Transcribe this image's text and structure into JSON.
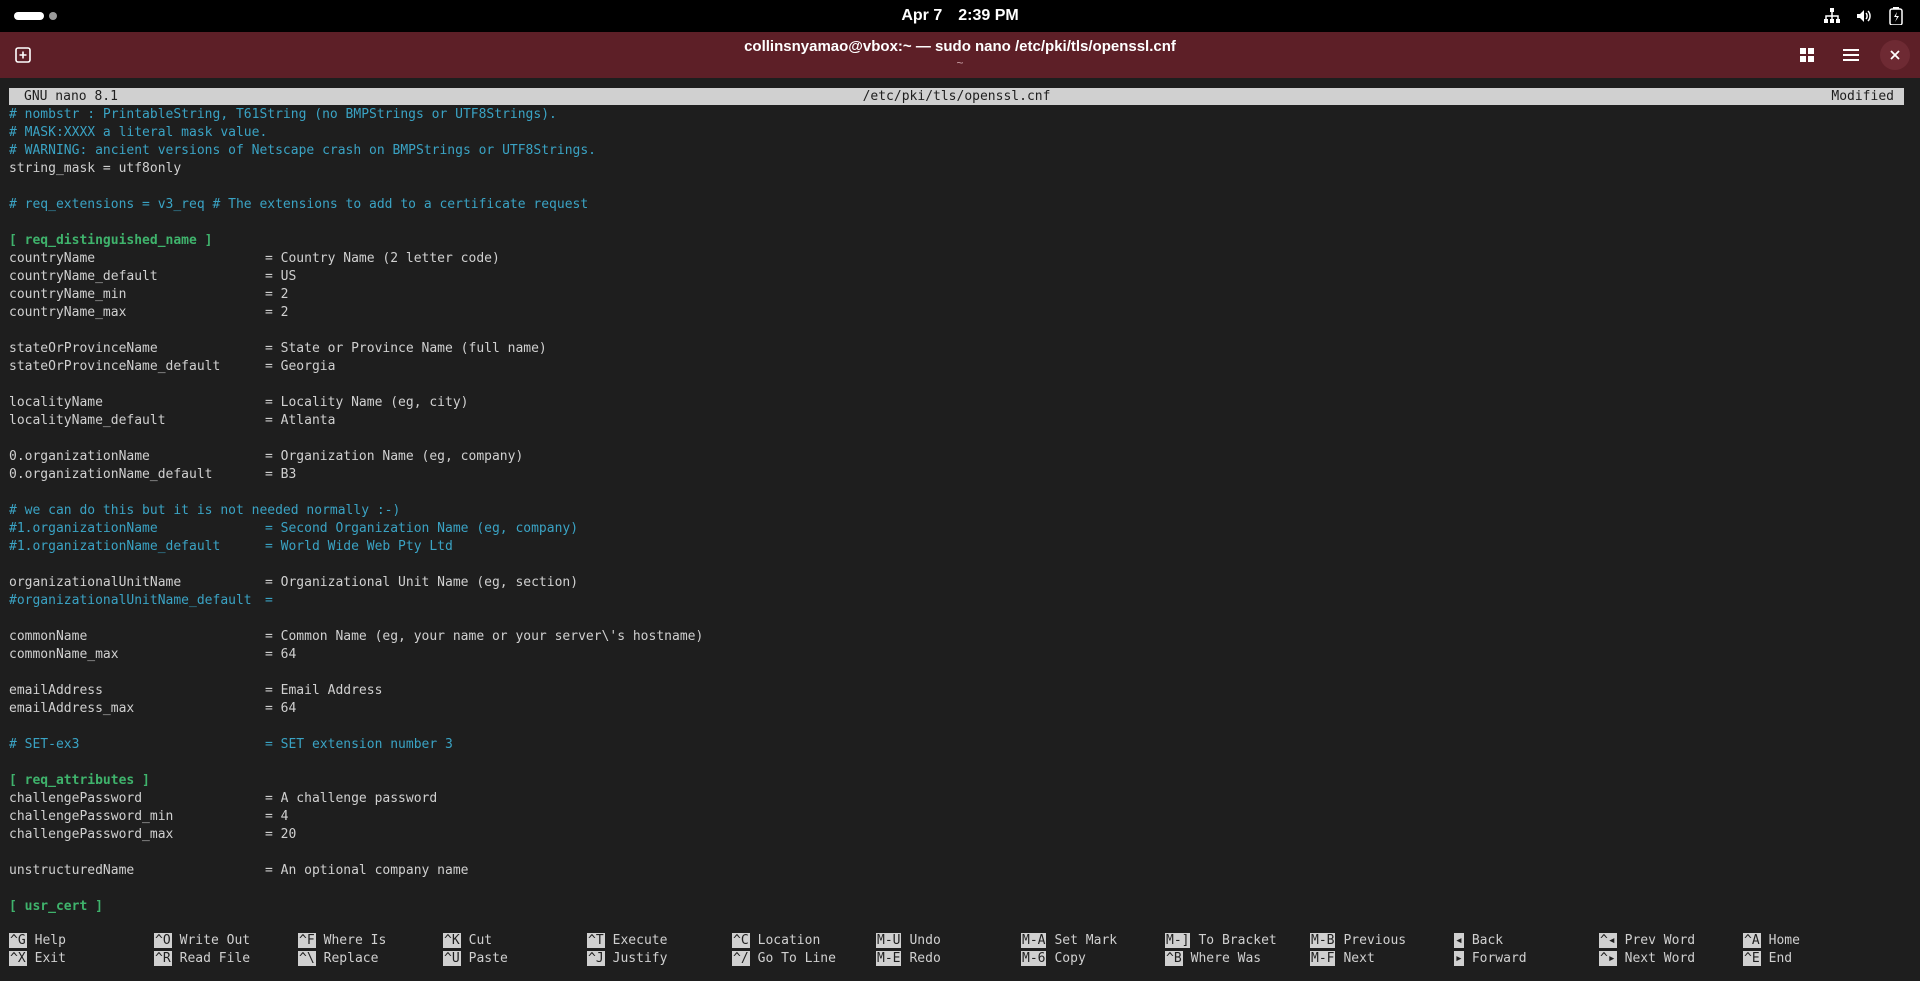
{
  "system_bar": {
    "date": "Apr 7",
    "time": "2:39 PM",
    "icons": [
      "network-icon",
      "volume-icon",
      "battery-icon"
    ]
  },
  "window": {
    "title": "collinsnyamao@vbox:~ — sudo nano /etc/pki/tls/openssl.cnf",
    "subtitle": "~"
  },
  "nano": {
    "version": "GNU nano 8.1",
    "filename": "/etc/pki/tls/openssl.cnf",
    "status": "Modified",
    "lines": [
      {
        "type": "comment",
        "text": "# nombstr : PrintableString, T61String (no BMPStrings or UTF8Strings)."
      },
      {
        "type": "comment",
        "text": "# MASK:XXXX a literal mask value."
      },
      {
        "type": "comment",
        "text": "# WARNING: ancient versions of Netscape crash on BMPStrings or UTF8Strings."
      },
      {
        "type": "text",
        "text": "string_mask = utf8only"
      },
      {
        "type": "blank",
        "text": ""
      },
      {
        "type": "comment",
        "text": "# req_extensions = v3_req # The extensions to add to a certificate request"
      },
      {
        "type": "blank",
        "text": ""
      },
      {
        "type": "section",
        "text": "[ req_distinguished_name ]"
      },
      {
        "type": "kv",
        "key": "countryName",
        "value": "= Country Name (2 letter code)"
      },
      {
        "type": "kv",
        "key": "countryName_default",
        "value": "= US"
      },
      {
        "type": "kv",
        "key": "countryName_min",
        "value": "= 2"
      },
      {
        "type": "kv",
        "key": "countryName_max",
        "value": "= 2"
      },
      {
        "type": "blank",
        "text": ""
      },
      {
        "type": "kv",
        "key": "stateOrProvinceName",
        "value": "= State or Province Name (full name)"
      },
      {
        "type": "kv",
        "key": "stateOrProvinceName_default",
        "value": "= Georgia"
      },
      {
        "type": "blank",
        "text": ""
      },
      {
        "type": "kv",
        "key": "localityName",
        "value": "= Locality Name (eg, city)"
      },
      {
        "type": "kv",
        "key": "localityName_default",
        "value": "= Atlanta"
      },
      {
        "type": "blank",
        "text": ""
      },
      {
        "type": "kv",
        "key": "0.organizationName",
        "value": "= Organization Name (eg, company)"
      },
      {
        "type": "kv",
        "key": "0.organizationName_default",
        "value": "= B3"
      },
      {
        "type": "blank",
        "text": ""
      },
      {
        "type": "comment",
        "text": "# we can do this but it is not needed normally :-)"
      },
      {
        "type": "ckv",
        "key": "#1.organizationName",
        "value": "= Second Organization Name (eg, company)"
      },
      {
        "type": "ckv",
        "key": "#1.organizationName_default",
        "value": "= World Wide Web Pty Ltd"
      },
      {
        "type": "blank",
        "text": ""
      },
      {
        "type": "kv",
        "key": "organizationalUnitName",
        "value": "= Organizational Unit Name (eg, section)"
      },
      {
        "type": "ckv",
        "key": "#organizationalUnitName_default",
        "value": "="
      },
      {
        "type": "blank",
        "text": ""
      },
      {
        "type": "kv",
        "key": "commonName",
        "value": "= Common Name (eg, your name or your server\\'s hostname)"
      },
      {
        "type": "kv",
        "key": "commonName_max",
        "value": "= 64"
      },
      {
        "type": "blank",
        "text": ""
      },
      {
        "type": "kv",
        "key": "emailAddress",
        "value": "= Email Address"
      },
      {
        "type": "kv",
        "key": "emailAddress_max",
        "value": "= 64"
      },
      {
        "type": "blank",
        "text": ""
      },
      {
        "type": "ckv",
        "key": "# SET-ex3",
        "value": "= SET extension number 3"
      },
      {
        "type": "blank",
        "text": ""
      },
      {
        "type": "section",
        "text": "[ req_attributes ]"
      },
      {
        "type": "kv",
        "key": "challengePassword",
        "value": "= A challenge password"
      },
      {
        "type": "kv",
        "key": "challengePassword_min",
        "value": "= 4"
      },
      {
        "type": "kv",
        "key": "challengePassword_max",
        "value": "= 20"
      },
      {
        "type": "blank",
        "text": ""
      },
      {
        "type": "kv",
        "key": "unstructuredName",
        "value": "= An optional company name"
      },
      {
        "type": "blank",
        "text": ""
      },
      {
        "type": "section",
        "text": "[ usr_cert ]"
      }
    ],
    "shortcuts": [
      [
        {
          "key": "^G",
          "label": "Help"
        },
        {
          "key": "^X",
          "label": "Exit"
        }
      ],
      [
        {
          "key": "^O",
          "label": "Write Out"
        },
        {
          "key": "^R",
          "label": "Read File"
        }
      ],
      [
        {
          "key": "^F",
          "label": "Where Is"
        },
        {
          "key": "^\\",
          "label": "Replace"
        }
      ],
      [
        {
          "key": "^K",
          "label": "Cut"
        },
        {
          "key": "^U",
          "label": "Paste"
        }
      ],
      [
        {
          "key": "^T",
          "label": "Execute"
        },
        {
          "key": "^J",
          "label": "Justify"
        }
      ],
      [
        {
          "key": "^C",
          "label": "Location"
        },
        {
          "key": "^/",
          "label": "Go To Line"
        }
      ],
      [
        {
          "key": "M-U",
          "label": "Undo"
        },
        {
          "key": "M-E",
          "label": "Redo"
        }
      ],
      [
        {
          "key": "M-A",
          "label": "Set Mark"
        },
        {
          "key": "M-6",
          "label": "Copy"
        }
      ],
      [
        {
          "key": "M-]",
          "label": "To Bracket"
        },
        {
          "key": "^B",
          "label": "Where Was"
        }
      ],
      [
        {
          "key": "M-B",
          "label": "Previous"
        },
        {
          "key": "M-F",
          "label": "Next"
        }
      ],
      [
        {
          "key": "◂",
          "label": "Back"
        },
        {
          "key": "▸",
          "label": "Forward"
        }
      ],
      [
        {
          "key": "^◂",
          "label": "Prev Word"
        },
        {
          "key": "^▸",
          "label": "Next Word"
        }
      ],
      [
        {
          "key": "^A",
          "label": "Home"
        },
        {
          "key": "^E",
          "label": "End"
        }
      ]
    ]
  }
}
